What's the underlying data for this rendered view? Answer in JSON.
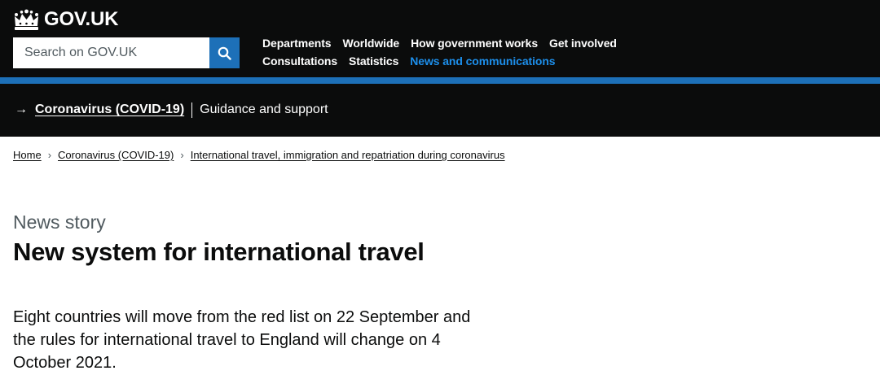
{
  "header": {
    "logo_text": "GOV.UK",
    "search": {
      "placeholder": "Search on GOV.UK",
      "button_icon": "search-icon"
    },
    "nav_row1": [
      "Departments",
      "Worldwide",
      "How government works",
      "Get involved"
    ],
    "nav_row2": [
      "Consultations",
      "Statistics",
      "News and communications"
    ],
    "active_nav": "News and communications"
  },
  "banner": {
    "arrow": "→",
    "link": "Coronavirus (COVID-19)",
    "text": "Guidance and support"
  },
  "breadcrumbs": [
    "Home",
    "Coronavirus (COVID-19)",
    "International travel, immigration and repatriation during coronavirus"
  ],
  "page": {
    "caption": "News story",
    "title": "New system for international travel",
    "lead": "Eight countries will move from the red list on 22 September and the rules for international travel to England will change on 4 October 2021."
  },
  "colors": {
    "header_bg": "#0b0c0c",
    "brand_blue": "#1d70b8",
    "active_link": "#1d8feb",
    "secondary_text": "#505a5f"
  }
}
